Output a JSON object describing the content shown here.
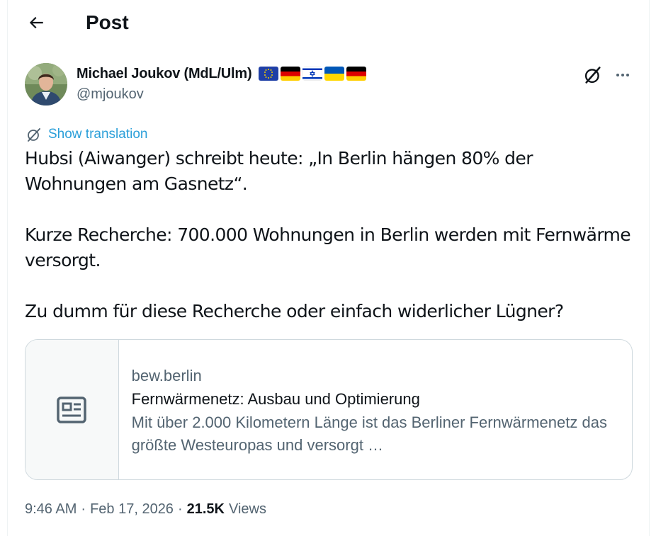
{
  "header": {
    "title": "Post",
    "back_icon": "arrow-left-icon"
  },
  "author": {
    "display_name": "Michael Joukov (MdL/Ulm)",
    "handle": "@mjoukov",
    "flags": [
      "eu-flag-icon",
      "germany-flag-icon",
      "israel-flag-icon",
      "ukraine-flag-icon",
      "germany-flag-icon"
    ]
  },
  "actions": {
    "grok_icon": "grok-icon",
    "more_icon": "more-horizontal-icon"
  },
  "translate": {
    "label": "Show translation",
    "icon": "grok-icon"
  },
  "tweet": {
    "paragraphs": [
      "Hubsi (Aiwanger) schreibt heute: „In Berlin hängen 80% der Wohnungen am Gasnetz“.",
      "Kurze Recherche: 700.000 Wohnungen in Berlin werden mit Fernwärme versorgt.",
      "Zu dumm für diese Recherche oder einfach widerlicher Lügner?"
    ]
  },
  "card": {
    "icon": "article-icon",
    "domain": "bew.berlin",
    "title": "Fernwärmenetz: Ausbau und Optimierung",
    "description": "Mit über 2.000 Kilometern Länge ist das Berliner Fernwärmenetz das größte Westeuropas und versorgt …"
  },
  "meta": {
    "time": "9:46 AM",
    "sep1": "·",
    "date": "Feb 17, 2026",
    "sep2": "·",
    "views_count": "21.5K",
    "views_label": "Views"
  },
  "colors": {
    "accent": "#1d9bf0",
    "text": "#0f1419",
    "secondary": "#536471",
    "border": "#cfd9de"
  }
}
